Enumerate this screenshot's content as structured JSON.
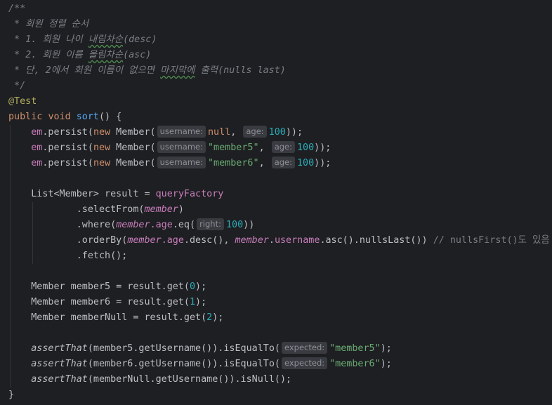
{
  "code": {
    "comment": {
      "open": "/**",
      "line1": " * 회원 정렬 순서",
      "line2_prefix": " * 1. 회원 나이 ",
      "line2_word": "내림차순",
      "line2_suffix": "(desc)",
      "line3_prefix": " * 2. 회원 이름 ",
      "line3_word": "올림차순",
      "line3_suffix": "(asc)",
      "line4_prefix": " * 단, 2에서 회원 이름이 없으면 ",
      "line4_word": "마지막에",
      "line4_suffix": " 출력(nulls last)",
      "close": " */"
    },
    "annotation": "@Test",
    "decl": {
      "kw_public": "public",
      "kw_void": "void",
      "name": "sort",
      "rest": "() {"
    },
    "persist": [
      {
        "em": "em",
        "call": ".persist(",
        "kw_new": "new",
        "cls": " Member(",
        "hint1": "username:",
        "arg1": "null",
        "arg1_type": "kw",
        "sep": ", ",
        "hint2": "age:",
        "arg2": "100",
        "tail": "));"
      },
      {
        "em": "em",
        "call": ".persist(",
        "kw_new": "new",
        "cls": " Member(",
        "hint1": "username:",
        "arg1": "\"member5\"",
        "arg1_type": "str",
        "sep": ", ",
        "hint2": "age:",
        "arg2": "100",
        "tail": "));"
      },
      {
        "em": "em",
        "call": ".persist(",
        "kw_new": "new",
        "cls": " Member(",
        "hint1": "username:",
        "arg1": "\"member6\"",
        "arg1_type": "str",
        "sep": ", ",
        "hint2": "age:",
        "arg2": "100",
        "tail": "));"
      }
    ],
    "query": {
      "decl": "List<Member> result = ",
      "factory": "queryFactory",
      "select_prefix": ".selectFrom(",
      "select_arg": "member",
      "select_suffix": ")",
      "where_prefix": ".where(",
      "where_member": "member",
      "where_field": ".age.eq(",
      "where_hint": "right:",
      "where_num": "100",
      "where_suffix": "))",
      "order_prefix": ".orderBy(",
      "order_member1": "member",
      "order_mid1": ".age.desc(), ",
      "order_member2": "member",
      "order_dot": ".",
      "order_username": "username",
      "order_mid2": ".asc().nullsLast()) ",
      "order_comment": "// nullsFirst()도 있음",
      "fetch": ".fetch();"
    },
    "gets": [
      {
        "decl": "Member member5 = result.get(",
        "idx": "0",
        "tail": ");"
      },
      {
        "decl": "Member member6 = result.get(",
        "idx": "1",
        "tail": ");"
      },
      {
        "decl": "Member memberNull = result.get(",
        "idx": "2",
        "tail": ");"
      }
    ],
    "asserts": [
      {
        "fn": "assertThat",
        "mid": "(member5.getUsername()).isEqualTo(",
        "hint": "expected:",
        "val": "\"member5\"",
        "tail": ");"
      },
      {
        "fn": "assertThat",
        "mid": "(member6.getUsername()).isEqualTo(",
        "hint": "expected:",
        "val": "\"member6\"",
        "tail": ");"
      },
      {
        "fn": "assertThat",
        "mid": "(memberNull.getUsername()).isNull();"
      }
    ],
    "close_brace": "}"
  }
}
